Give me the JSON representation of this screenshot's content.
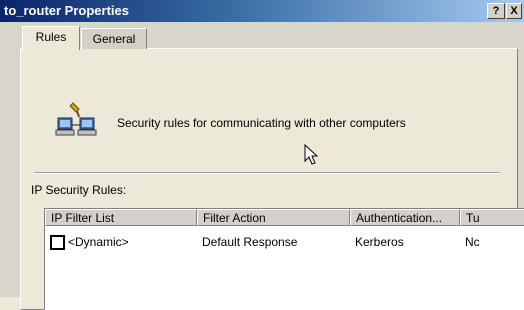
{
  "window": {
    "title": "to_router Properties",
    "help_label": "?",
    "close_label": "X"
  },
  "tabs": [
    {
      "label": "Rules",
      "selected": true
    },
    {
      "label": "General",
      "selected": false
    }
  ],
  "rules_panel": {
    "icon": "network-computers-icon",
    "description": "Security rules for communicating with other computers",
    "list_label": "IP Security Rules:",
    "columns": [
      "IP Filter List",
      "Filter Action",
      "Authentication...",
      "Tu"
    ],
    "rows": [
      {
        "checked": false,
        "filter_list": "<Dynamic>",
        "filter_action": "Default Response",
        "authentication": "Kerberos",
        "tunnel": "Nc"
      }
    ]
  },
  "colors": {
    "titlebar_start": "#0a246a",
    "titlebar_end": "#a6caf0",
    "dialog_face": "#ece9d8"
  }
}
